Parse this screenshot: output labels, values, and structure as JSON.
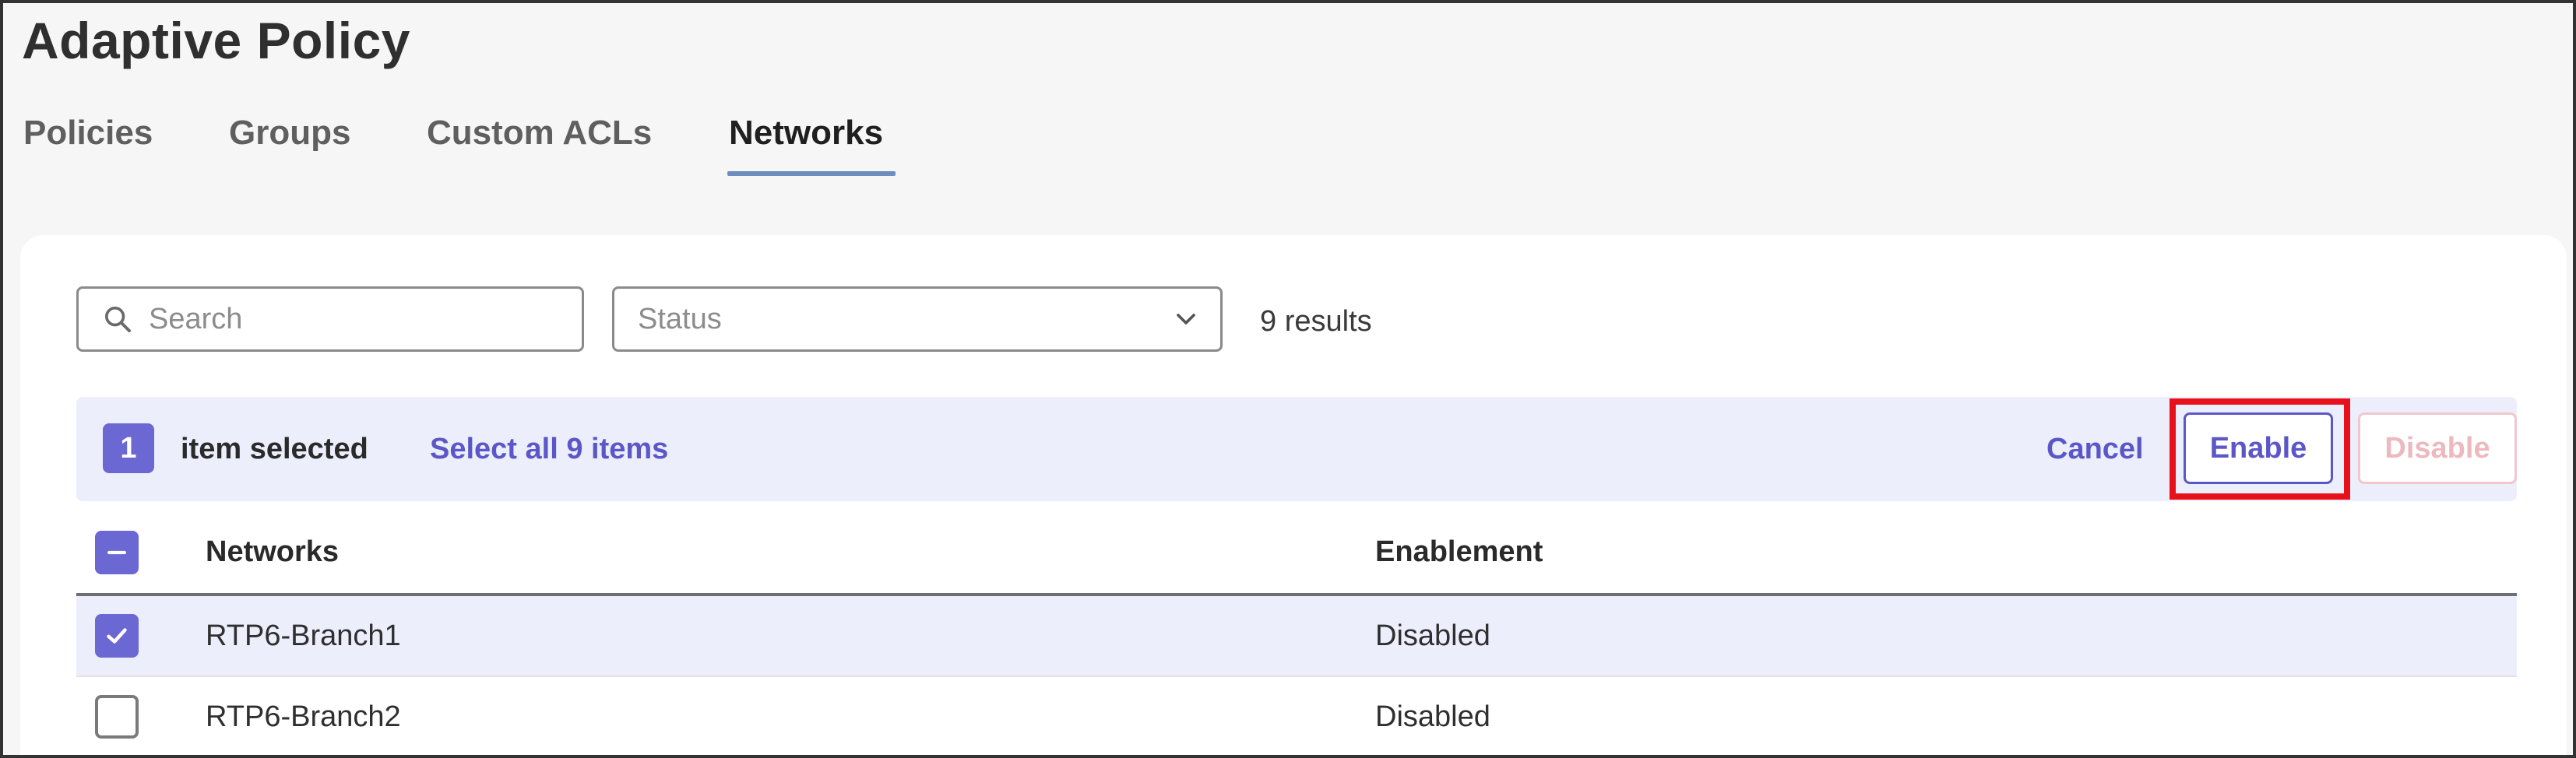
{
  "page": {
    "title": "Adaptive Policy"
  },
  "tabs": [
    {
      "label": "Policies",
      "active": false
    },
    {
      "label": "Groups",
      "active": false
    },
    {
      "label": "Custom ACLs",
      "active": false
    },
    {
      "label": "Networks",
      "active": true
    }
  ],
  "filters": {
    "search_placeholder": "Search",
    "search_value": "",
    "status_placeholder": "Status",
    "results_text": "9 results"
  },
  "selection_bar": {
    "count": "1",
    "selected_text": "item selected",
    "select_all_label": "Select all 9 items",
    "cancel_label": "Cancel",
    "enable_label": "Enable",
    "disable_label": "Disable"
  },
  "table": {
    "columns": [
      "Networks",
      "Enablement"
    ],
    "rows": [
      {
        "network": "RTP6-Branch1",
        "enablement": "Disabled",
        "checked": true
      },
      {
        "network": "RTP6-Branch2",
        "enablement": "Disabled",
        "checked": false
      }
    ]
  },
  "colors": {
    "accent": "#6b67d3",
    "link": "#5b57c8",
    "selection_bg": "#eceefc",
    "highlight": "#e8101a",
    "tab_underline": "#6b8ebf"
  },
  "icons": {
    "search": "search-icon",
    "status_dropdown": "chevron-down-icon",
    "header_checkbox": "minus-icon",
    "row_checkbox": "check-icon"
  }
}
